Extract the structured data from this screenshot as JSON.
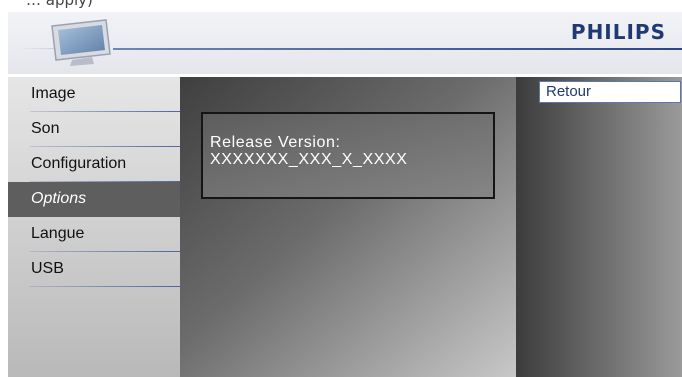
{
  "top_text": "… apply)",
  "header": {
    "brand": "PHILIPS",
    "icon": "tv-icon"
  },
  "menu": {
    "items": [
      {
        "label": "Image",
        "selected": false
      },
      {
        "label": "Son",
        "selected": false
      },
      {
        "label": "Configuration",
        "selected": false
      },
      {
        "label": "Options",
        "selected": true
      },
      {
        "label": "Langue",
        "selected": false
      },
      {
        "label": "USB",
        "selected": false
      }
    ]
  },
  "info": {
    "line1": "Release Version:",
    "line2": "XXXXXXX_XXX_X_XXXX"
  },
  "actions": {
    "return_label": "Retour"
  },
  "colors": {
    "brand": "#1f3a73",
    "accent_line": "#29477f",
    "selected_bg": "#5e5e5e"
  }
}
